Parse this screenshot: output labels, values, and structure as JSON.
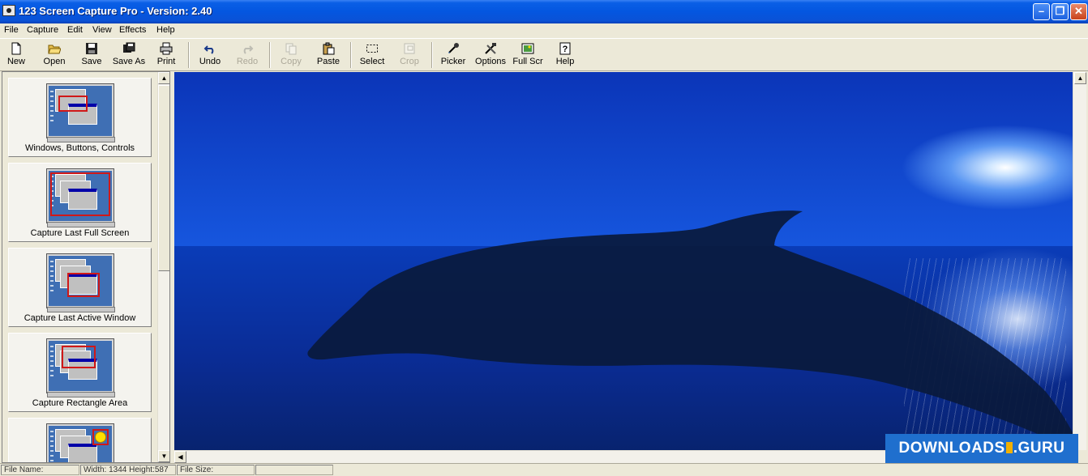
{
  "window": {
    "title": "123 Screen Capture Pro - Version: 2.40",
    "minimize_icon": "minimize-icon",
    "maximize_icon": "restore-icon",
    "close_icon": "close-icon"
  },
  "menu": {
    "items": [
      "File",
      "Capture",
      "Edit",
      "View",
      "Effects",
      "Help"
    ]
  },
  "toolbar": {
    "buttons": [
      {
        "label": "New",
        "icon": "new-file-icon",
        "enabled": true
      },
      {
        "label": "Open",
        "icon": "open-folder-icon",
        "enabled": true
      },
      {
        "label": "Save",
        "icon": "floppy-disk-icon",
        "enabled": true
      },
      {
        "label": "Save As",
        "icon": "save-as-icon",
        "enabled": true
      },
      {
        "label": "Print",
        "icon": "printer-icon",
        "enabled": true
      },
      {
        "label": "Undo",
        "icon": "undo-icon",
        "enabled": true
      },
      {
        "label": "Redo",
        "icon": "redo-icon",
        "enabled": false
      },
      {
        "label": "Copy",
        "icon": "copy-icon",
        "enabled": false
      },
      {
        "label": "Paste",
        "icon": "paste-icon",
        "enabled": true
      },
      {
        "label": "Select",
        "icon": "select-icon",
        "enabled": true
      },
      {
        "label": "Crop",
        "icon": "crop-icon",
        "enabled": false
      },
      {
        "label": "Picker",
        "icon": "eyedropper-icon",
        "enabled": true
      },
      {
        "label": "Options",
        "icon": "tools-icon",
        "enabled": true
      },
      {
        "label": "Full Scr",
        "icon": "full-screen-icon",
        "enabled": true
      },
      {
        "label": "Help",
        "icon": "help-icon",
        "enabled": true
      }
    ]
  },
  "capture_modes": [
    {
      "label": "Windows, Buttons, Controls"
    },
    {
      "label": "Capture Last Full Screen"
    },
    {
      "label": "Capture Last Active Window"
    },
    {
      "label": "Capture Rectangle Area"
    },
    {
      "label": ""
    }
  ],
  "status": {
    "file_name": "File Name:",
    "dimensions": "Width: 1344  Height:587",
    "file_size": "File Size:"
  },
  "watermark": {
    "text_left": "DOWNLOADS",
    "text_right": ".GURU"
  },
  "colors": {
    "titlebar": "#0456e0",
    "face": "#ece9d8",
    "close_button": "#c9431c",
    "watermark": "#1f6fce"
  }
}
